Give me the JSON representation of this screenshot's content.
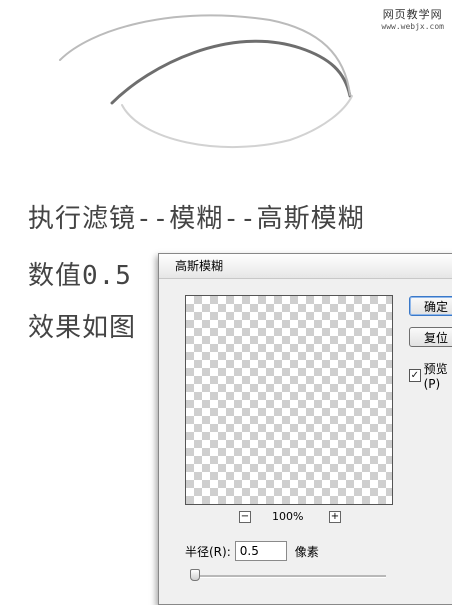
{
  "watermark": {
    "site_name": "网页教学网",
    "url": "www.webjx.com"
  },
  "instructions": {
    "line1": "执行滤镜--模糊--高斯模糊",
    "line2": "数值0.5",
    "line3": "效果如图"
  },
  "dialog": {
    "title": "高斯模糊",
    "ok_label": "确定",
    "reset_label": "复位",
    "preview_label": "预览(P)",
    "preview_checked": true,
    "zoom_out": "−",
    "zoom_in": "+",
    "zoom_level": "100%",
    "radius_label": "半径(R):",
    "radius_value": "0.5",
    "radius_unit": "像素",
    "radius_slider_level": 0.0
  }
}
